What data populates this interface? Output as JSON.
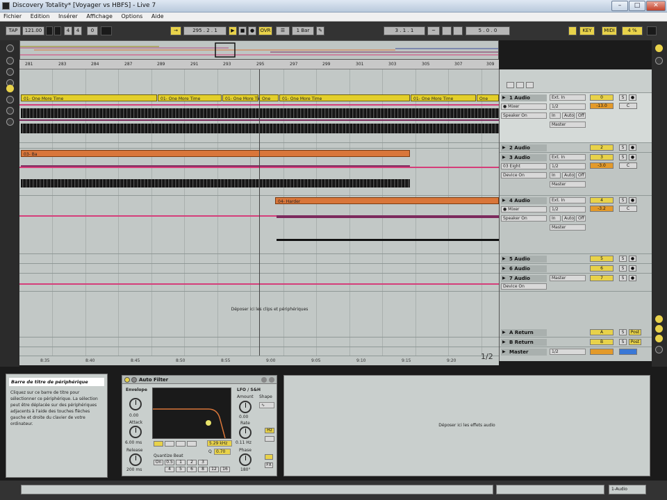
{
  "window": {
    "title": "Discovery Totality* [Voyager vs HBFS] - Live 7",
    "minimize": "–",
    "maximize": "□",
    "close": "✕"
  },
  "menu": [
    "Fichier",
    "Edition",
    "Insérer",
    "Affichage",
    "Options",
    "Aide"
  ],
  "transport": {
    "tap": "TAP",
    "tempo": "121.00",
    "sig_num": "4",
    "sig_den": "4",
    "counter": "0",
    "position": "295 . 2 . 1",
    "ovr": "OVR",
    "quantize": "1 Bar",
    "loop_start": "3 . 1 . 1",
    "loop_length": "5 . 0 . 0",
    "key": "KEY",
    "midi": "MIDI",
    "cpu": "4 %"
  },
  "ruler_labels": [
    "281",
    "283",
    "284",
    "287",
    "289",
    "291",
    "293",
    "295",
    "297",
    "299",
    "301",
    "303",
    "305",
    "307",
    "309"
  ],
  "clips": {
    "track1": "01- One More Time",
    "track1_short": "01- One More Time",
    "track1_mid": "01- One More Time",
    "track1_tiny": "One",
    "track3": "03- Ba",
    "track4": "04- Harder"
  },
  "drop_zone_text": "Déposer ici les clips et périphériques",
  "time_labels": [
    "8:35",
    "8:40",
    "8:45",
    "8:50",
    "8:55",
    "9:00",
    "9:05",
    "9:10",
    "9:15",
    "9:20"
  ],
  "page_indicator": "1/2",
  "tracks": [
    {
      "name": "1 Audio",
      "input": "Ext. In",
      "input2": "● Mixer",
      "ch": "1/2",
      "monitor": "In",
      "monitor2": "Auto",
      "monitor3": "Off",
      "out_device": "Speaker On",
      "out": "Master",
      "vol": "0",
      "pan": "-13.0",
      "sends": "C"
    },
    {
      "name": "2 Audio",
      "vol": "2"
    },
    {
      "name": "3 Audio",
      "input": "Ext. In",
      "input2": "03 Eight",
      "ch": "1/2",
      "monitor": "In",
      "monitor2": "Auto",
      "monitor3": "Off",
      "out_device": "Device On",
      "out": "Master",
      "vol": "3",
      "pan": "-3.0",
      "sends": "C"
    },
    {
      "name": "4 Audio",
      "input": "Ext. In",
      "input2": "● Mixer",
      "ch": "1/2",
      "monitor": "In",
      "monitor2": "Auto",
      "monitor3": "Off",
      "out_device": "Speaker On",
      "out": "Master",
      "vol": "4",
      "pan": "-3.2",
      "sends": "C"
    },
    {
      "name": "5 Audio",
      "vol": "5"
    },
    {
      "name": "6 Audio",
      "vol": "6"
    },
    {
      "name": "7 Audio",
      "out": "Master",
      "out_device": "Device On",
      "vol": "7"
    }
  ],
  "returns": [
    {
      "name": "A Return",
      "vol": "A",
      "btn": "Post"
    },
    {
      "name": "B Return",
      "vol": "B",
      "btn": "Post"
    },
    {
      "name": "Master",
      "out": "1/2"
    }
  ],
  "info": {
    "title": "Barre de titre de périphérique",
    "body": "Cliquez sur ce barre de titre pour sélectionner ce périphérique. La sélection peut être déplacée sur des périphériques adjacents à l'aide des touches flèches gauche et droite du clavier de votre ordinateur."
  },
  "device": {
    "name": "Auto Filter",
    "envelope": "Envelope",
    "env_val": "0.00",
    "attack": "Attack",
    "attack_val": "6.00 ms",
    "release": "Release",
    "release_val": "200 ms",
    "freq": "5.29 kHz",
    "q": "Q",
    "q_val": "0.70",
    "quantize": "Quantize Beat",
    "q_btns": [
      "On",
      "0.5",
      "1",
      "2",
      "3",
      "4",
      "5",
      "6",
      "8",
      "12",
      "16"
    ],
    "lfo": "LFO / S&H",
    "amount": "Amount",
    "amount_val": "0.00",
    "shape": "Shape",
    "rate": "Rate",
    "rate_val": "0.11 Hz",
    "phase": "Phase",
    "phase_val": "180°",
    "hz": "Hz",
    "fx": "FX"
  },
  "drop_fx_text": "Déposer ici les effets audio",
  "status": {
    "track_label": "1-Audio"
  }
}
